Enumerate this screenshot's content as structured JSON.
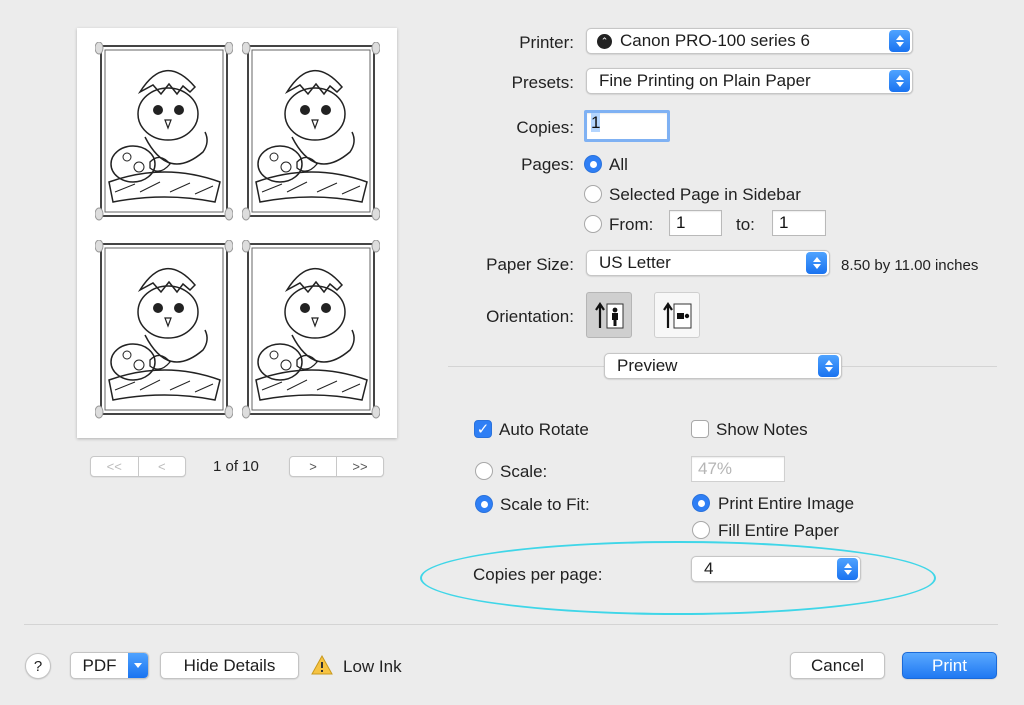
{
  "preview": {
    "page_indicator": "1 of 10",
    "nav": {
      "first": "<<",
      "prev": "<",
      "next": ">",
      "last": ">>"
    }
  },
  "printer": {
    "label": "Printer:",
    "value": "Canon PRO-100 series 6"
  },
  "presets": {
    "label": "Presets:",
    "value": "Fine Printing on Plain Paper"
  },
  "copies": {
    "label": "Copies:",
    "value": "1"
  },
  "pages": {
    "label": "Pages:",
    "all": "All",
    "selected_sidebar": "Selected Page in Sidebar",
    "from_label": "From:",
    "from_value": "1",
    "to_label": "to:",
    "to_value": "1"
  },
  "paper_size": {
    "label": "Paper Size:",
    "value": "US Letter",
    "dimensions": "8.50 by 11.00 inches"
  },
  "orientation": {
    "label": "Orientation:"
  },
  "section_popup": {
    "value": "Preview"
  },
  "options": {
    "auto_rotate": "Auto Rotate",
    "show_notes": "Show Notes",
    "scale_label": "Scale:",
    "scale_value": "47%",
    "scale_to_fit": "Scale to Fit:",
    "print_entire_image": "Print Entire Image",
    "fill_entire_paper": "Fill Entire Paper",
    "copies_per_page_label": "Copies per page:",
    "copies_per_page_value": "4"
  },
  "footer": {
    "help": "?",
    "pdf": "PDF",
    "hide_details": "Hide Details",
    "warning": "Low Ink",
    "cancel": "Cancel",
    "print": "Print"
  },
  "colors": {
    "accent": "#2f7ff5",
    "highlight_ellipse": "#3fd6e8"
  }
}
